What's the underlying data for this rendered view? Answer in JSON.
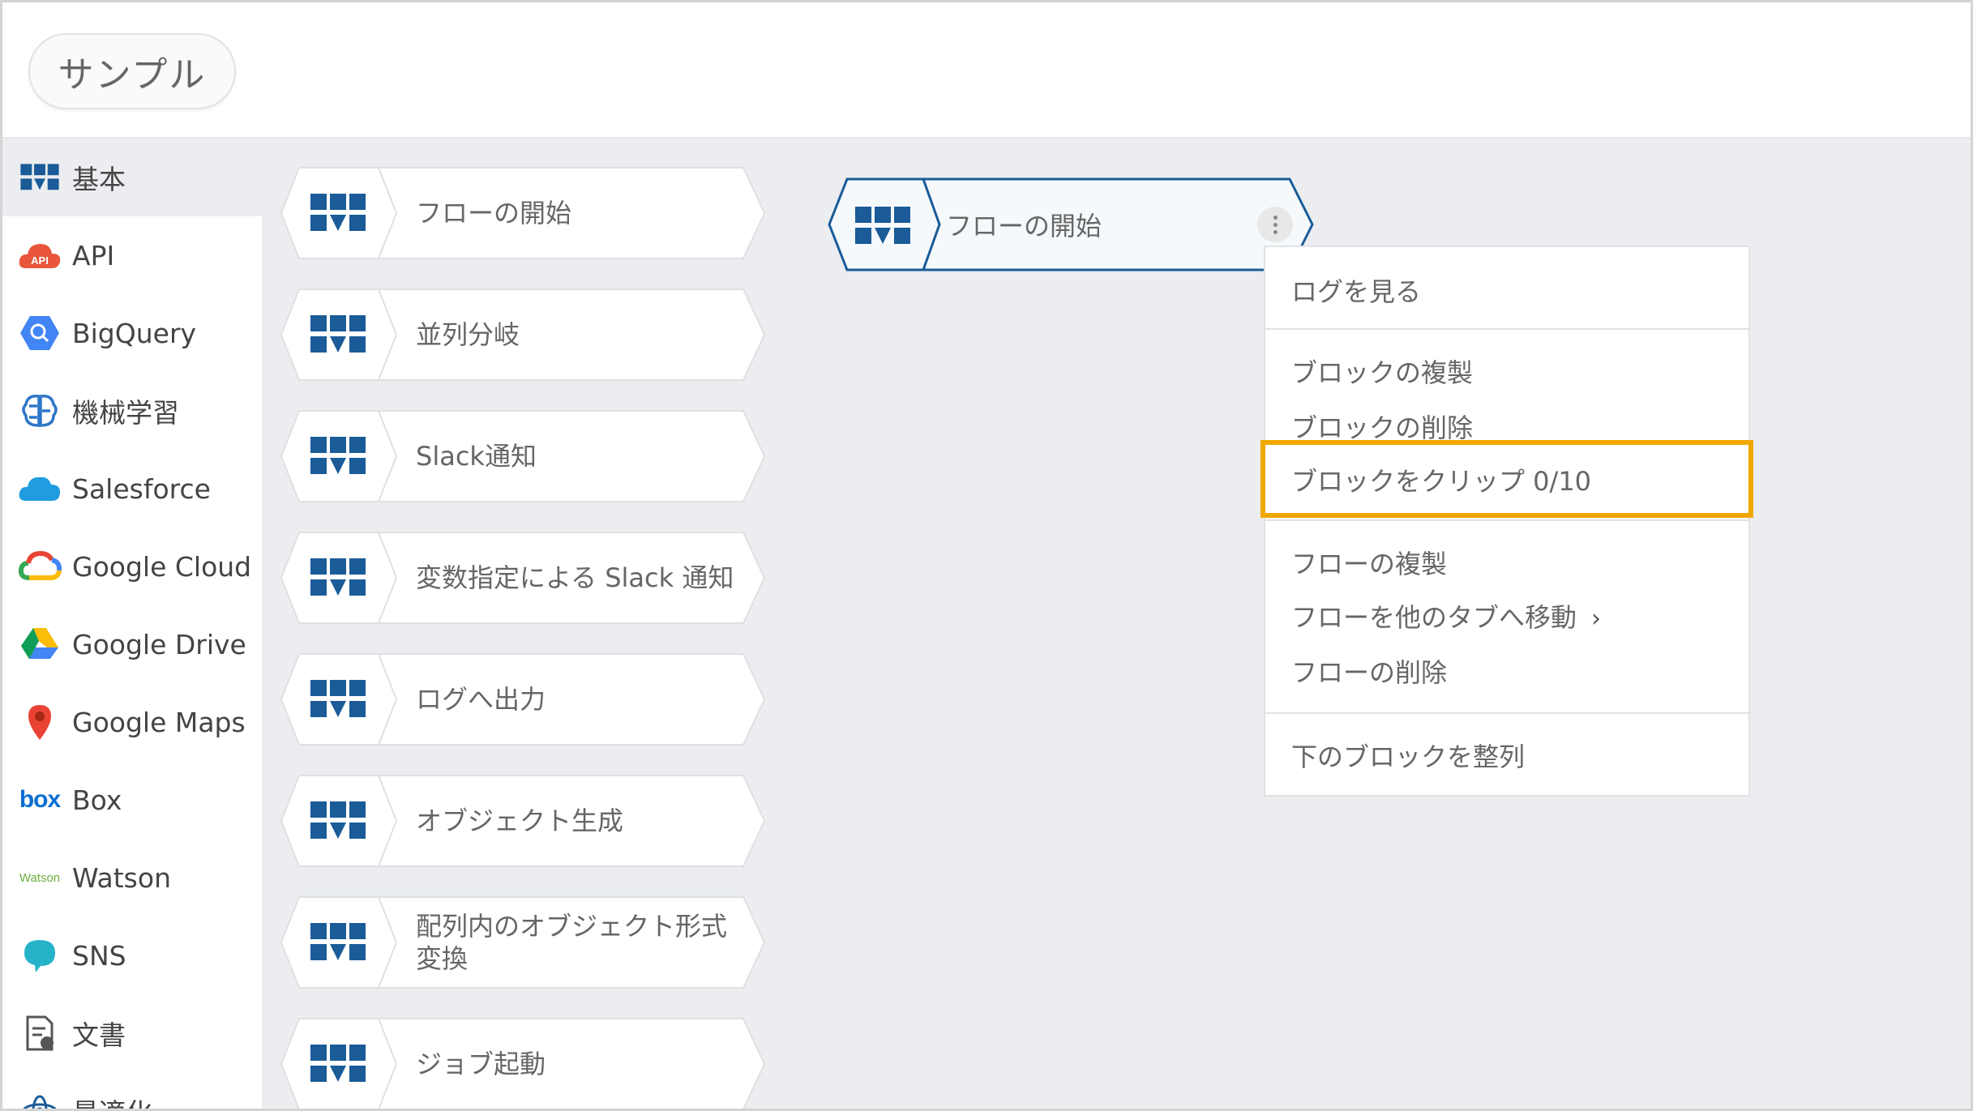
{
  "header": {
    "tab_label": "サンプル"
  },
  "sidebar": {
    "items": [
      {
        "label": "基本",
        "icon": "basic-blocks-icon"
      },
      {
        "label": "API",
        "icon": "api-cloud-icon"
      },
      {
        "label": "BigQuery",
        "icon": "bigquery-icon"
      },
      {
        "label": "機械学習",
        "icon": "brain-icon"
      },
      {
        "label": "Salesforce",
        "icon": "salesforce-cloud-icon"
      },
      {
        "label": "Google Cloud",
        "icon": "google-cloud-icon"
      },
      {
        "label": "Google Drive",
        "icon": "google-drive-icon"
      },
      {
        "label": "Google Maps",
        "icon": "google-maps-pin-icon"
      },
      {
        "label": "Box",
        "icon": "box-logo-icon",
        "logo_text": "box"
      },
      {
        "label": "Watson",
        "icon": "watson-logo-icon",
        "logo_text": "Watson"
      },
      {
        "label": "SNS",
        "icon": "chat-bubble-icon"
      },
      {
        "label": "文書",
        "icon": "document-icon"
      },
      {
        "label": "最適化",
        "icon": "optimization-icon"
      }
    ]
  },
  "palette": {
    "blocks": [
      {
        "label": "フローの開始"
      },
      {
        "label": "並列分岐"
      },
      {
        "label": "Slack通知"
      },
      {
        "label": "変数指定による Slack 通知"
      },
      {
        "label": "ログへ出力"
      },
      {
        "label": "オブジェクト生成"
      },
      {
        "label": "配列内のオブジェクト形式変換"
      },
      {
        "label": "ジョブ起動"
      }
    ]
  },
  "canvas": {
    "block_label": "フローの開始"
  },
  "menu": {
    "view_log": "ログを見る",
    "duplicate_block": "ブロックの複製",
    "delete_block": "ブロックの削除",
    "clip_block": "ブロックをクリップ 0/10",
    "duplicate_flow": "フローの複製",
    "move_flow": "フローを他のタブへ移動",
    "move_flow_chevron": "›",
    "delete_flow": "フローの削除",
    "align_blocks": "下のブロックを整列"
  },
  "colors": {
    "accent": "#1a5b98",
    "highlight": "#f0a800",
    "panel_bg": "#ebedf0"
  }
}
